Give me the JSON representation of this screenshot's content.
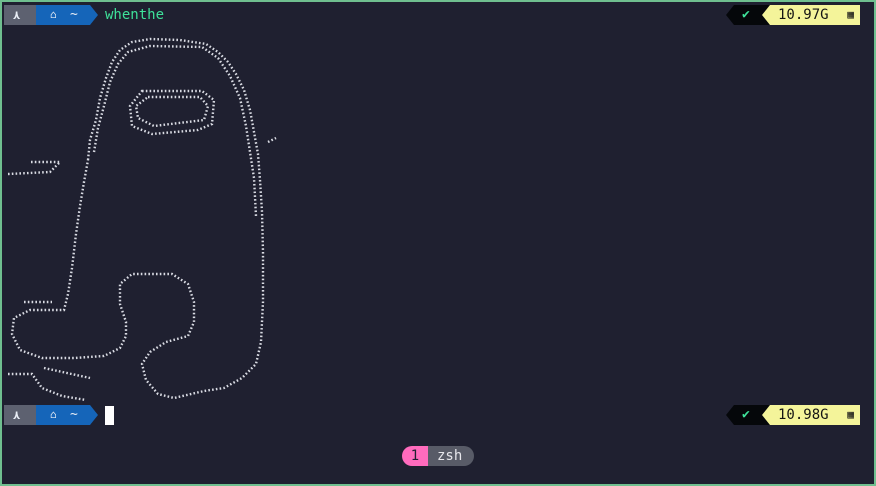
{
  "terminal": {
    "prompt": {
      "os_icon": "arch-icon",
      "os_glyph": "⋏",
      "home_icon": "home-icon",
      "home_glyph": "⌂",
      "dir": "~"
    },
    "history": {
      "command": "whenthe"
    },
    "status": {
      "exit_ok_icon": "check-icon",
      "exit_ok_glyph": "✔",
      "memory_before": "10.97G",
      "memory_after": "10.98G",
      "ram_icon": "ram-icon",
      "ram_glyph": "▦"
    },
    "colors": {
      "background": "#1f2030",
      "border": "#6fbf8f",
      "os_segment": "#5d6170",
      "dir_segment": "#1565b9",
      "command_text": "#3ee19a",
      "memory_segment": "#f4f49a",
      "status_segment": "#05070a",
      "tmux_index": "#ff6bbd",
      "tmux_name": "#585b67"
    }
  },
  "tmux": {
    "window_index": "1",
    "window_name": "zsh"
  }
}
